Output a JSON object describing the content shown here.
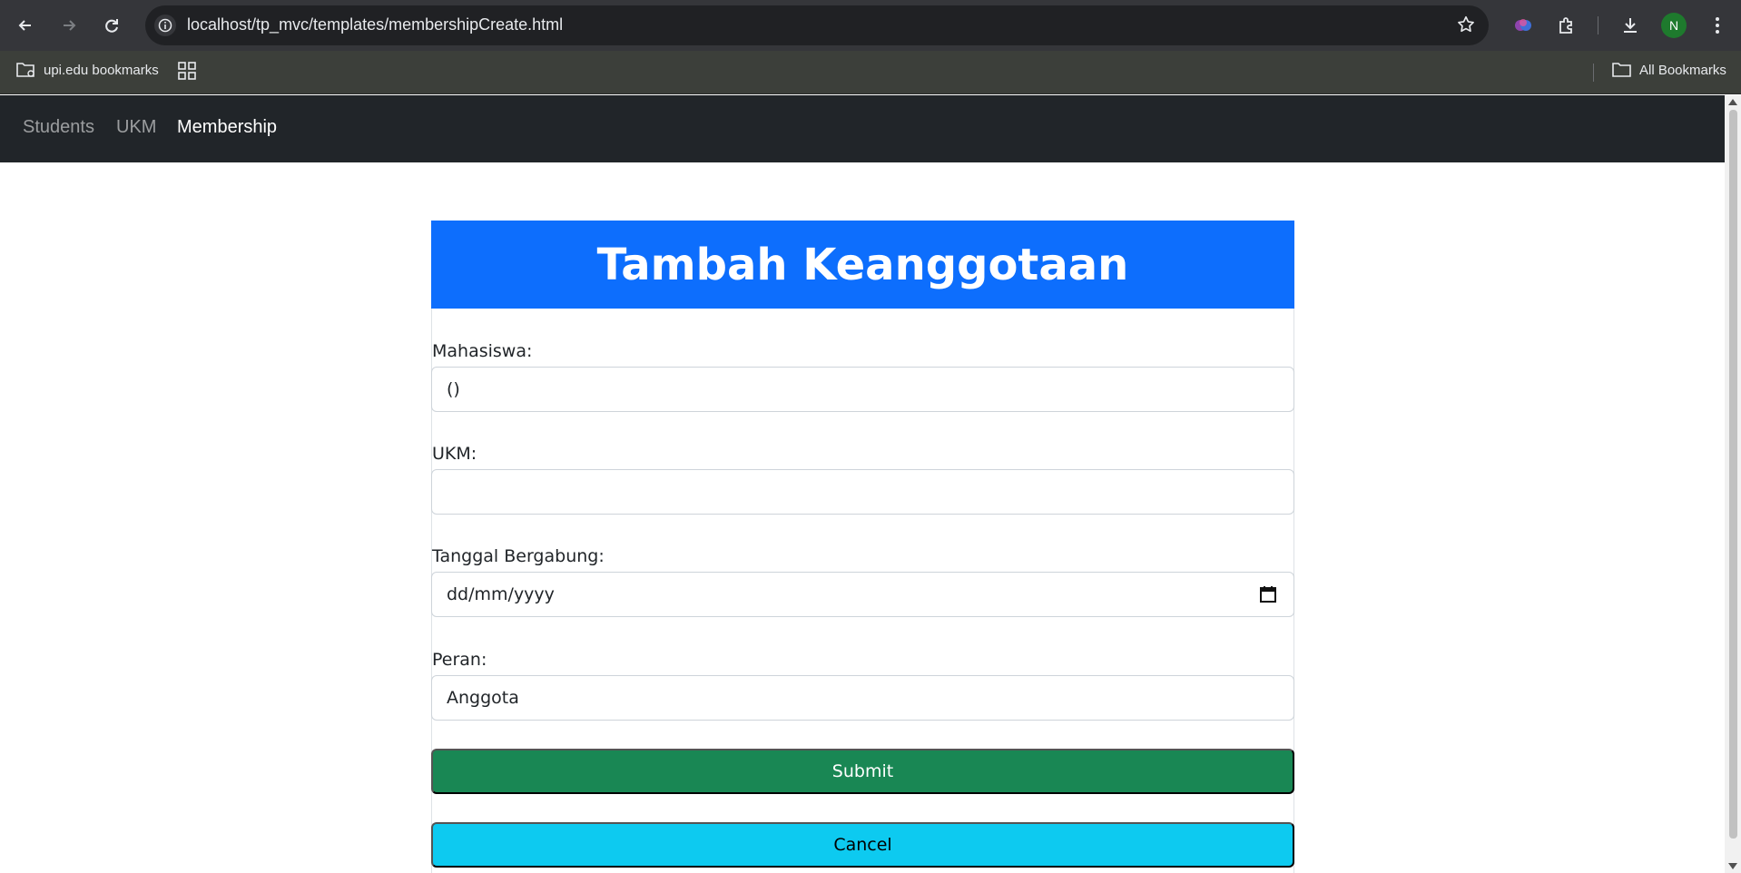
{
  "browser": {
    "url": "localhost/tp_mvc/templates/membershipCreate.html",
    "profile_initial": "N",
    "bookmarks": {
      "folder_label": "upi.edu bookmarks",
      "all_bookmarks_label": "All Bookmarks"
    }
  },
  "navbar": {
    "links": [
      {
        "label": "Students",
        "active": false
      },
      {
        "label": "UKM",
        "active": false
      },
      {
        "label": "Membership",
        "active": true
      }
    ]
  },
  "form": {
    "title": "Tambah Keanggotaan",
    "fields": {
      "mahasiswa": {
        "label": "Mahasiswa:",
        "value": "()"
      },
      "ukm": {
        "label": "UKM:",
        "value": ""
      },
      "tanggal": {
        "label": "Tanggal Bergabung:",
        "value": "dd/mm/yyyy"
      },
      "peran": {
        "label": "Peran:",
        "value": "Anggota"
      }
    },
    "submit_label": "Submit",
    "cancel_label": "Cancel"
  },
  "colors": {
    "header_bg": "#0d6efd",
    "submit_bg": "#198754",
    "cancel_bg": "#0dcaf0",
    "navbar_bg": "#212529"
  }
}
